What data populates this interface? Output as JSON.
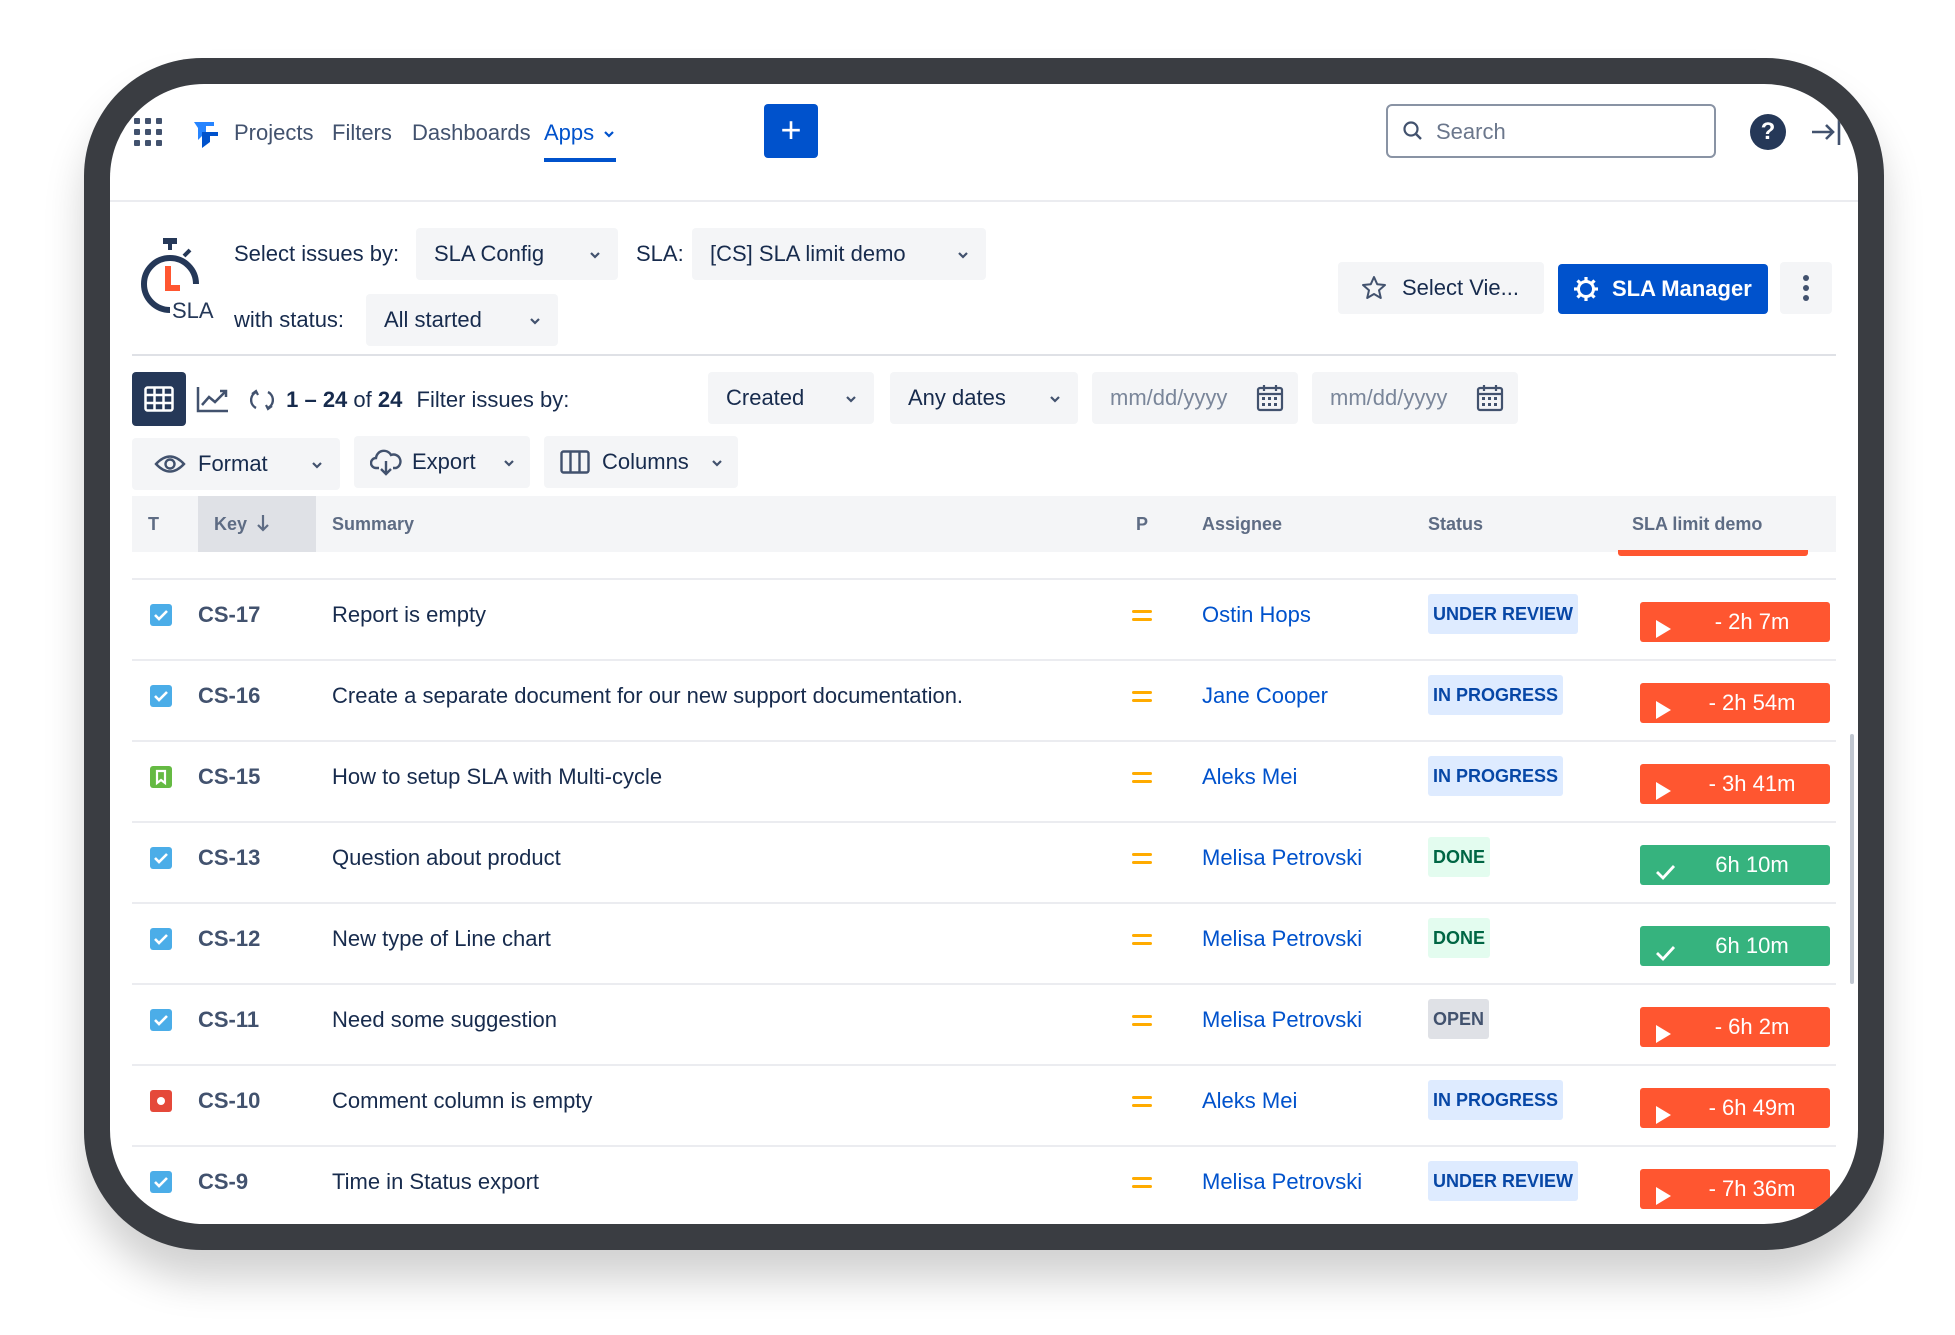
{
  "nav": {
    "items": [
      "Projects",
      "Filters",
      "Dashboards",
      "Apps"
    ],
    "active": "Apps",
    "plus_label": "+",
    "search_placeholder": "Search",
    "help_label": "?"
  },
  "sla_bar": {
    "logo_text": "SLA",
    "select_by_label": "Select issues by:",
    "select_by_value": "SLA Config",
    "sla_label": "SLA:",
    "sla_value": "[CS] SLA limit demo",
    "status_label": "with status:",
    "status_value": "All started",
    "select_view_label": "Select Vie...",
    "sla_manager_label": "SLA Manager"
  },
  "toolbar": {
    "count_range": "1 – 24",
    "count_of": "of",
    "count_total": "24",
    "filter_label": "Filter issues by:",
    "filter_field": "Created",
    "date_range": "Any dates",
    "date_from_placeholder": "mm/dd/yyyy",
    "date_to_placeholder": "mm/dd/yyyy",
    "format_label": "Format",
    "export_label": "Export",
    "columns_label": "Columns"
  },
  "table": {
    "headers": {
      "type": "T",
      "key": "Key",
      "summary": "Summary",
      "priority": "P",
      "assignee": "Assignee",
      "status": "Status",
      "sla": "SLA limit demo"
    },
    "rows": [
      {
        "type": "task",
        "key": "CS-17",
        "summary": "Report is empty",
        "assignee": "Ostin Hops",
        "status": "UNDER REVIEW",
        "status_kind": "review",
        "sla": "- 2h 7m",
        "sla_state": "breached"
      },
      {
        "type": "task",
        "key": "CS-16",
        "summary": "Create a separate document for our new support documentation.",
        "assignee": "Jane Cooper",
        "status": "IN PROGRESS",
        "status_kind": "progress",
        "sla": "- 2h 54m",
        "sla_state": "breached"
      },
      {
        "type": "story",
        "key": "CS-15",
        "summary": "How to setup SLA with Multi-cycle",
        "assignee": "Aleks Mei",
        "status": "IN PROGRESS",
        "status_kind": "progress",
        "sla": "- 3h 41m",
        "sla_state": "breached"
      },
      {
        "type": "task",
        "key": "CS-13",
        "summary": "Question about product",
        "assignee": "Melisa Petrovski",
        "status": "DONE",
        "status_kind": "done",
        "sla": "6h 10m",
        "sla_state": "met"
      },
      {
        "type": "task",
        "key": "CS-12",
        "summary": "New type of Line chart",
        "assignee": "Melisa Petrovski",
        "status": "DONE",
        "status_kind": "done",
        "sla": "6h 10m",
        "sla_state": "met"
      },
      {
        "type": "task",
        "key": "CS-11",
        "summary": "Need some suggestion",
        "assignee": "Melisa Petrovski",
        "status": "OPEN",
        "status_kind": "open",
        "sla": "- 6h 2m",
        "sla_state": "breached"
      },
      {
        "type": "bug",
        "key": "CS-10",
        "summary": "Comment column is empty",
        "assignee": "Aleks Mei",
        "status": "IN PROGRESS",
        "status_kind": "progress",
        "sla": "- 6h 49m",
        "sla_state": "breached"
      },
      {
        "type": "task",
        "key": "CS-9",
        "summary": "Time in Status export",
        "assignee": "Melisa Petrovski",
        "status": "UNDER REVIEW",
        "status_kind": "review",
        "sla": "- 7h 36m",
        "sla_state": "breached"
      }
    ]
  },
  "colors": {
    "accent": "#0052cc",
    "breached": "#ff5630",
    "met": "#36b37e",
    "priority_medium": "#ffab00"
  }
}
